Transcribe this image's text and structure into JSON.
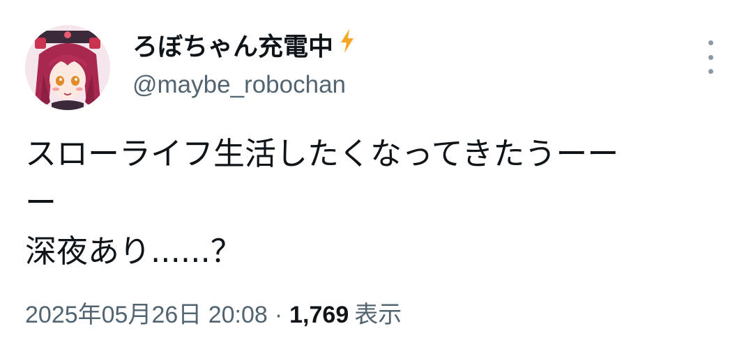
{
  "author": {
    "display_name": "ろぼちゃん充電中",
    "handle": "@maybe_robochan",
    "name_emoji": "lightning-bolt-icon",
    "accent_color": "#f5a623"
  },
  "tweet": {
    "lines": [
      "スローライフ生活したくなってきたうーー",
      "ー",
      "深夜あり......？"
    ]
  },
  "meta": {
    "timestamp": "2025年05月26日 20:08",
    "separator": "·",
    "views_count": "1,769",
    "views_label": "表示"
  },
  "icons": {
    "more": "more-vertical-icon",
    "avatar": "anime-robot-girl-avatar"
  }
}
